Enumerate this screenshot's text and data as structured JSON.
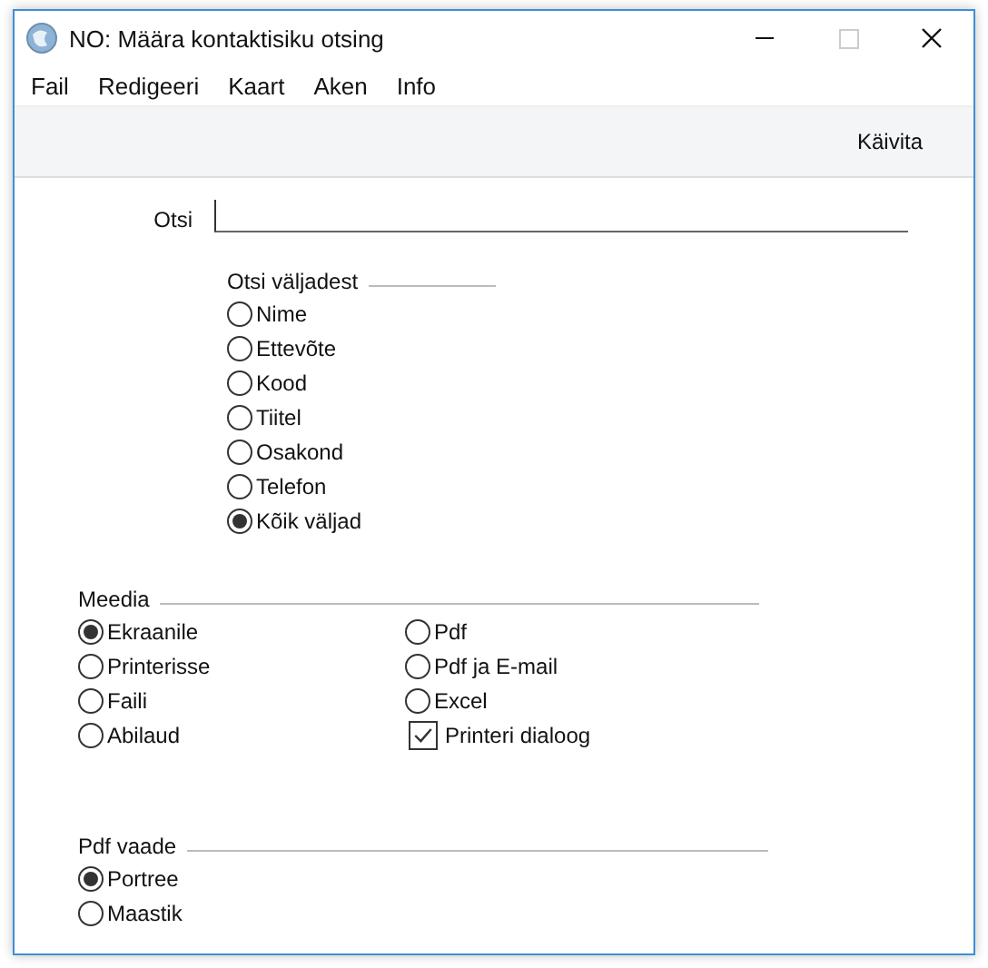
{
  "window": {
    "title": "NO: Määra kontaktisiku otsing"
  },
  "menu": [
    "Fail",
    "Redigeeri",
    "Kaart",
    "Aken",
    "Info"
  ],
  "toolbar": {
    "buttons": [
      "Käivita"
    ]
  },
  "search_field": {
    "label": "Otsi"
  },
  "search_in": {
    "title": "Otsi väljadest",
    "options": [
      {
        "kind": "radio",
        "label": "Nime",
        "selected": false
      },
      {
        "kind": "radio",
        "label": "Ettevõte",
        "selected": false
      },
      {
        "kind": "radio",
        "label": "Kood",
        "selected": false
      },
      {
        "kind": "radio",
        "label": "Tiitel",
        "selected": false
      },
      {
        "kind": "radio",
        "label": "Osakond",
        "selected": false
      },
      {
        "kind": "radio",
        "label": "Telefon",
        "selected": false
      },
      {
        "kind": "radio",
        "label": "Kõik väljad",
        "selected": true
      }
    ]
  },
  "media": {
    "title": "Meedia",
    "options": [
      {
        "kind": "radio",
        "label": "Ekraanile",
        "selected": true
      },
      {
        "kind": "radio",
        "label": "Printerisse",
        "selected": false
      },
      {
        "kind": "radio",
        "label": "Faili",
        "selected": false
      },
      {
        "kind": "radio",
        "label": "Abilaud",
        "selected": false
      },
      {
        "kind": "radio",
        "label": "Pdf",
        "selected": false
      },
      {
        "kind": "radio",
        "label": "Pdf ja E-mail",
        "selected": false
      },
      {
        "kind": "radio",
        "label": "Excel",
        "selected": false
      },
      {
        "kind": "checkbox",
        "label": "Printeri dialoog",
        "checked": true
      }
    ]
  },
  "pdf_view": {
    "title": "Pdf vaade",
    "options": [
      {
        "kind": "radio",
        "label": "Portree",
        "selected": true
      },
      {
        "kind": "radio",
        "label": "Maastik",
        "selected": false
      }
    ]
  }
}
